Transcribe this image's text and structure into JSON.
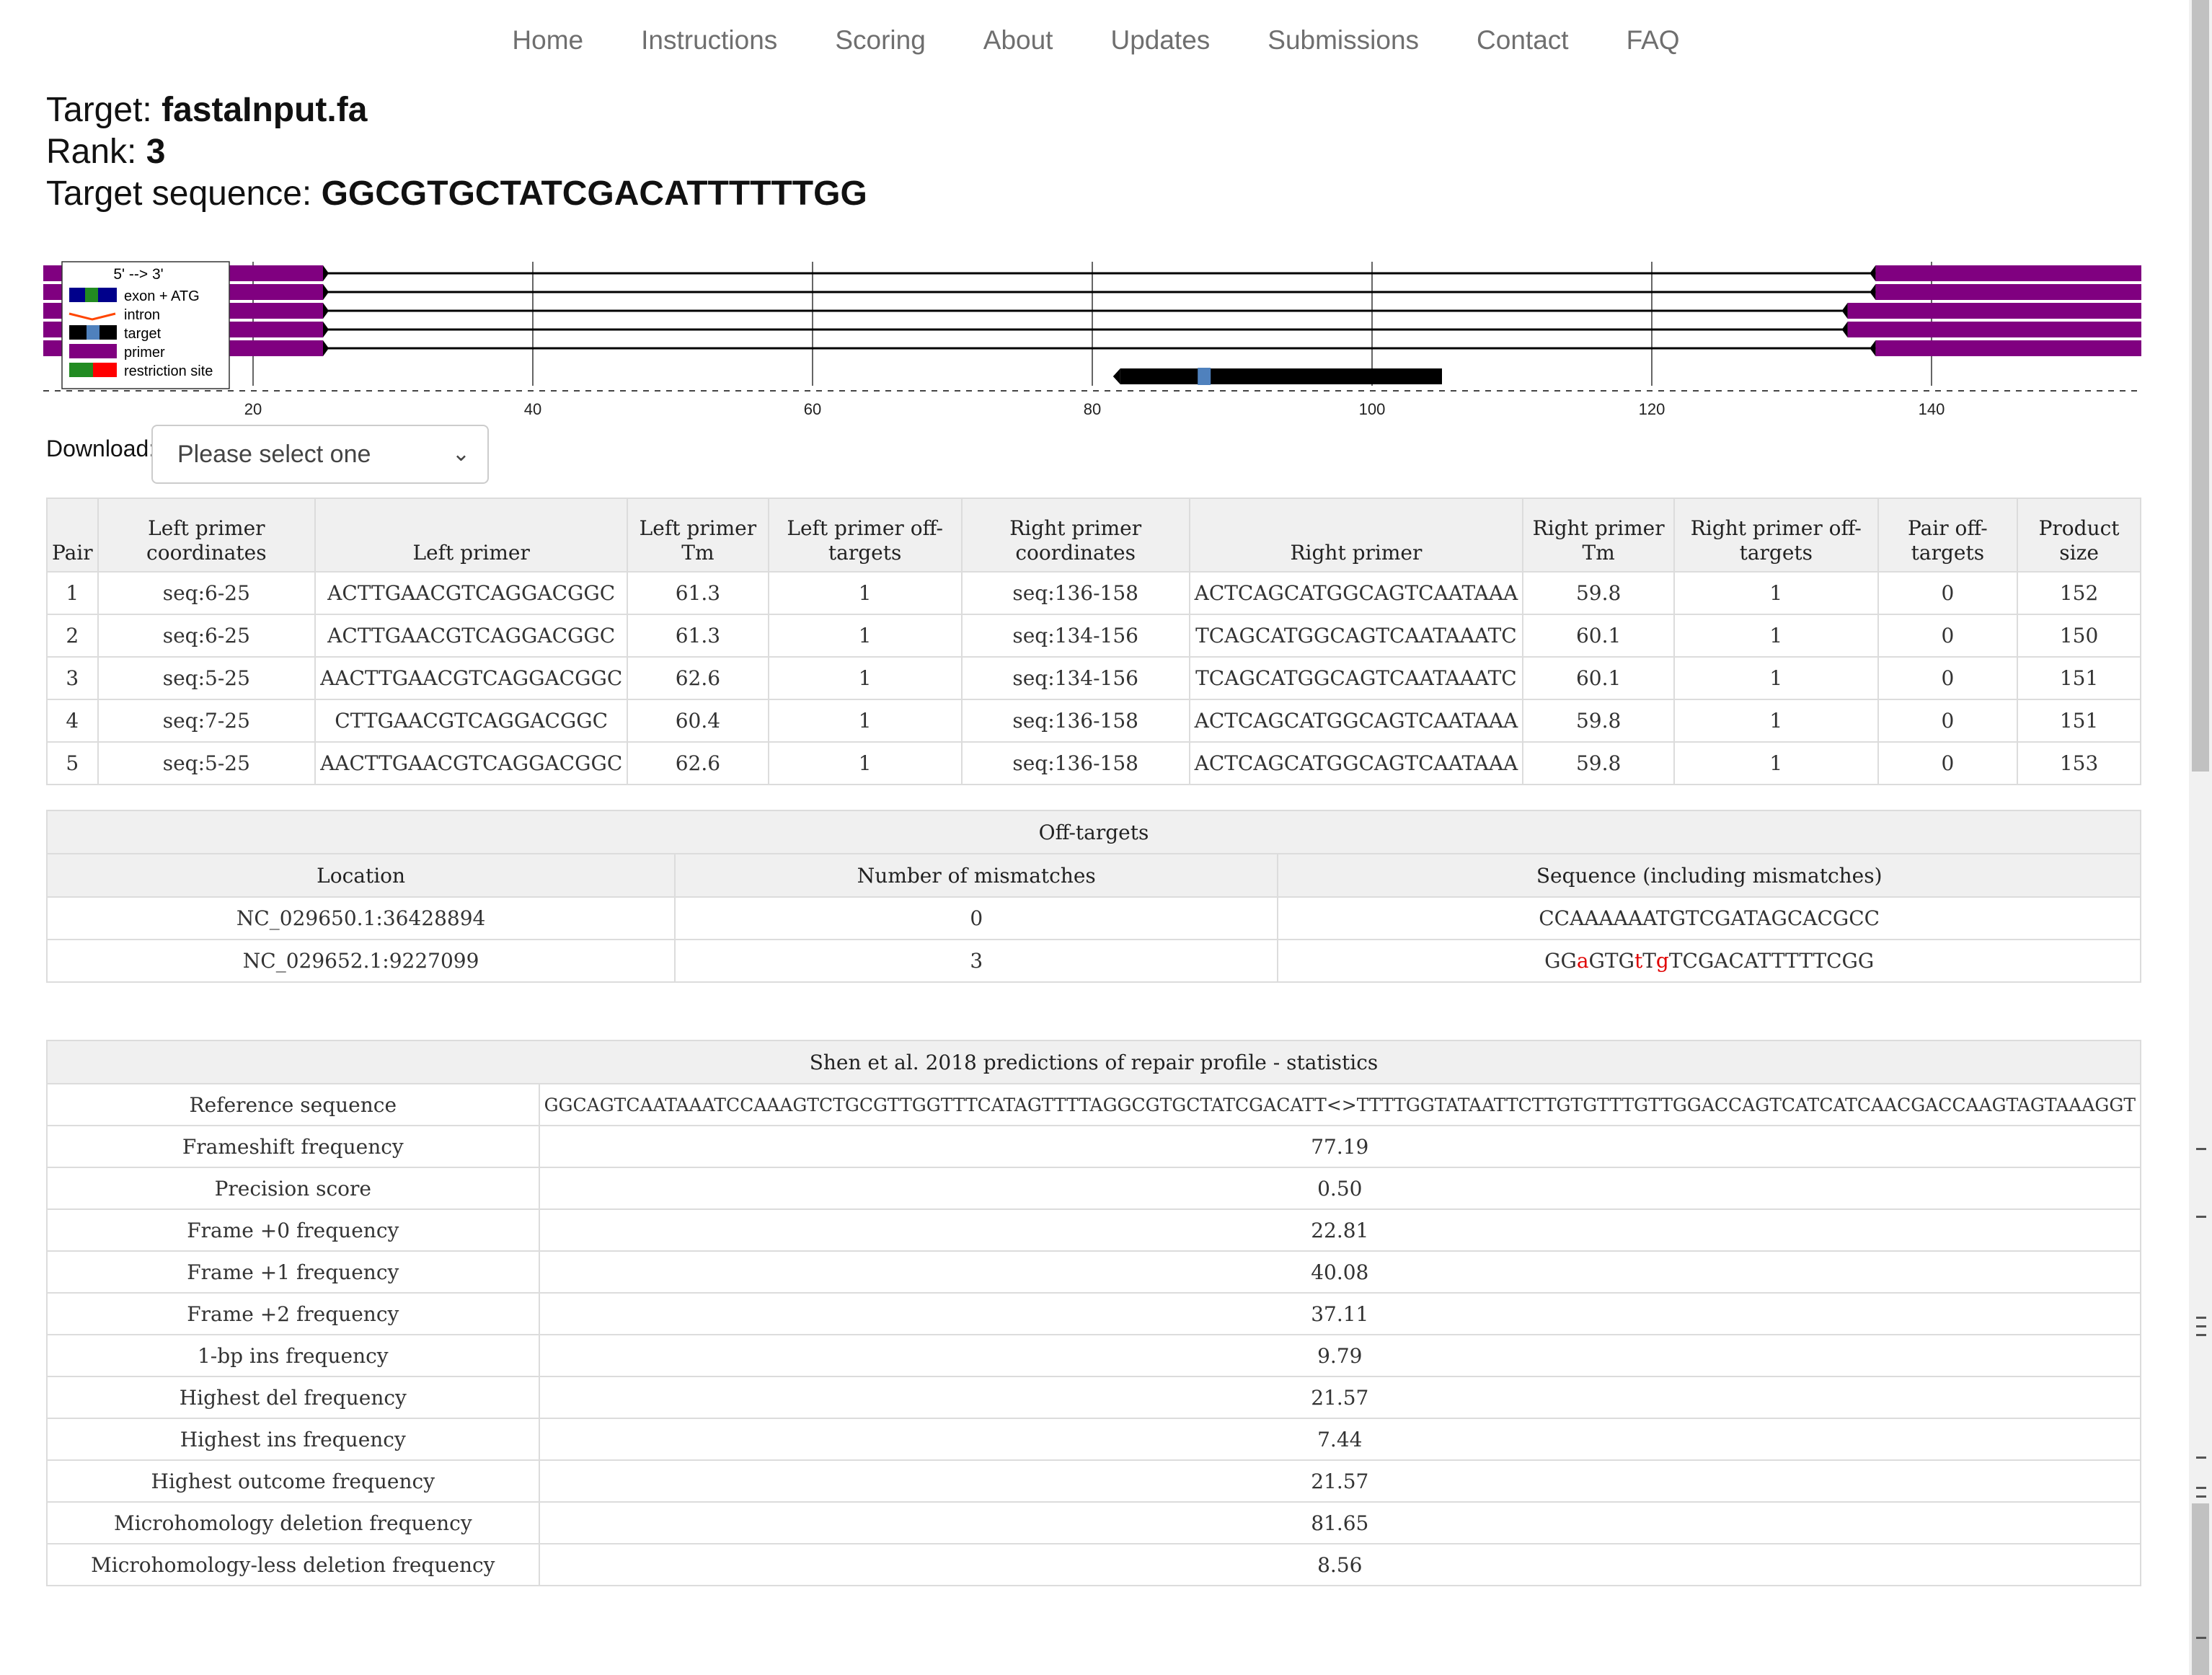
{
  "nav": [
    "Home",
    "Instructions",
    "Scoring",
    "About",
    "Updates",
    "Submissions",
    "Contact",
    "FAQ"
  ],
  "info": {
    "target_label": "Target: ",
    "target_value": "fastaInput.fa",
    "rank_label": "Rank: ",
    "rank_value": "3",
    "seq_label": "Target sequence: ",
    "seq_value": "GGCGTGCTATCGACATTTTTTGG"
  },
  "legend": {
    "title": "5' --> 3'",
    "items": [
      "exon + ATG",
      "intron",
      "target",
      "primer",
      "restriction site"
    ]
  },
  "viz": {
    "axis_ticks": [
      20,
      40,
      60,
      80,
      100,
      120,
      140
    ],
    "axis_range": [
      5,
      155
    ],
    "colors": {
      "primer": "#800080",
      "target": "#000000",
      "target_mark": "#4f81bd",
      "line": "#000000"
    },
    "primer_pairs": [
      {
        "left": [
          5,
          25
        ],
        "right": [
          136,
          158
        ]
      },
      {
        "left": [
          5,
          25
        ],
        "right": [
          136,
          158
        ]
      },
      {
        "left": [
          5,
          25
        ],
        "right": [
          134,
          156
        ]
      },
      {
        "left": [
          5,
          25
        ],
        "right": [
          134,
          156
        ]
      },
      {
        "left": [
          5,
          25
        ],
        "right": [
          136,
          158
        ]
      }
    ],
    "target_span": [
      82,
      105
    ],
    "target_mark": 88
  },
  "download": {
    "label": "Download:",
    "placeholder": "Please select one"
  },
  "primers": {
    "headers": [
      "Pair",
      "Left primer coordinates",
      "Left primer",
      "Left primer Tm",
      "Left primer off-targets",
      "Right primer coordinates",
      "Right primer",
      "Right primer Tm",
      "Right primer off-targets",
      "Pair off-targets",
      "Product size"
    ],
    "rows": [
      [
        "1",
        "seq:6-25",
        "ACTTGAACGTCAGGACGGC",
        "61.3",
        "1",
        "seq:136-158",
        "ACTCAGCATGGCAGTCAATAAA",
        "59.8",
        "1",
        "0",
        "152"
      ],
      [
        "2",
        "seq:6-25",
        "ACTTGAACGTCAGGACGGC",
        "61.3",
        "1",
        "seq:134-156",
        "TCAGCATGGCAGTCAATAAATC",
        "60.1",
        "1",
        "0",
        "150"
      ],
      [
        "3",
        "seq:5-25",
        "AACTTGAACGTCAGGACGGC",
        "62.6",
        "1",
        "seq:134-156",
        "TCAGCATGGCAGTCAATAAATC",
        "60.1",
        "1",
        "0",
        "151"
      ],
      [
        "4",
        "seq:7-25",
        "CTTGAACGTCAGGACGGC",
        "60.4",
        "1",
        "seq:136-158",
        "ACTCAGCATGGCAGTCAATAAA",
        "59.8",
        "1",
        "0",
        "151"
      ],
      [
        "5",
        "seq:5-25",
        "AACTTGAACGTCAGGACGGC",
        "62.6",
        "1",
        "seq:136-158",
        "ACTCAGCATGGCAGTCAATAAA",
        "59.8",
        "1",
        "0",
        "153"
      ]
    ]
  },
  "offtargets": {
    "title": "Off-targets",
    "headers": [
      "Location",
      "Number of mismatches",
      "Sequence (including mismatches)"
    ],
    "rows": [
      {
        "location": "NC_029650.1:36428894",
        "mismatches": "0",
        "seq": [
          {
            "t": "CCAAAAAATGTCGATAGCACGCC",
            "m": false
          }
        ]
      },
      {
        "location": "NC_029652.1:9227099",
        "mismatches": "3",
        "seq": [
          {
            "t": "GG",
            "m": false
          },
          {
            "t": "a",
            "m": true
          },
          {
            "t": "GTG",
            "m": false
          },
          {
            "t": "t",
            "m": true
          },
          {
            "t": "T",
            "m": false
          },
          {
            "t": "g",
            "m": true
          },
          {
            "t": "TCGACATTTTTCGG",
            "m": false
          }
        ]
      }
    ]
  },
  "repair": {
    "title": "Shen et al. 2018 predictions of repair profile - statistics",
    "rows": [
      [
        "Reference sequence",
        "GGCAGTCAATAAATCCAAAGTCTGCGTTGGTTTCATAGTTTTAGGCGTGCTATCGACATT<>TTTTGGTATAATTCTTGTGTTTGTTGGACCAGTCATCATCAACGACCAAGTAGTAAAGGT"
      ],
      [
        "Frameshift frequency",
        "77.19"
      ],
      [
        "Precision score",
        "0.50"
      ],
      [
        "Frame +0 frequency",
        "22.81"
      ],
      [
        "Frame +1 frequency",
        "40.08"
      ],
      [
        "Frame +2 frequency",
        "37.11"
      ],
      [
        "1-bp ins frequency",
        "9.79"
      ],
      [
        "Highest del frequency",
        "21.57"
      ],
      [
        "Highest ins frequency",
        "7.44"
      ],
      [
        "Highest outcome frequency",
        "21.57"
      ],
      [
        "Microhomology deletion frequency",
        "81.65"
      ],
      [
        "Microhomology-less deletion frequency",
        "8.56"
      ]
    ]
  }
}
